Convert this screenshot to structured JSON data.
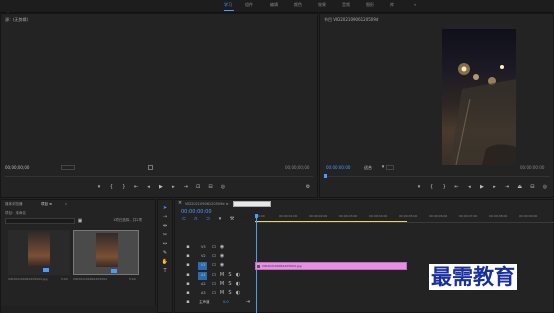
{
  "menubar": {
    "workspaces": [
      "学习",
      "组件",
      "编辑",
      "颜色",
      "效果",
      "音频",
      "图形",
      "库"
    ],
    "active_index": 0,
    "more": "»"
  },
  "source_panel": {
    "title": "源：(无剪辑)",
    "tc_left": "00;00;00;00",
    "tc_right": "00;00;00;00"
  },
  "program_panel": {
    "title": "节目 VID20210906120509d",
    "tc_left": "00:00:00:00",
    "fit": "适合",
    "tc_right": "00:00:00:00"
  },
  "project_panel": {
    "tabs": [
      "媒体浏览器",
      "项目 ≡",
      "»"
    ],
    "project_name": "项目：未命名",
    "search_placeholder": "",
    "items_label": "1项已选择，共2项",
    "items": [
      {
        "name": "VID20210906120509d.jpg",
        "duration": "5:00"
      },
      {
        "name": "VID20210906120509d",
        "duration": "5:00"
      }
    ]
  },
  "timeline": {
    "tab_label": "VID20210906120509d ≡",
    "tooltip": "标记点 (Ctrl+Shift+C)",
    "timecode": "00:00:00:00",
    "ruler": [
      ":00:00",
      "00:00:01:00",
      "00:00:02:00",
      "00:00:03:00",
      "00:00:04:00",
      "00:00:05:00",
      "00:00:06:00",
      "00:00:07:00",
      "00:00:08:00",
      "00:00:09:00"
    ],
    "video_tracks": [
      "V3",
      "V2",
      "V1"
    ],
    "audio_tracks": [
      "A1",
      "A2",
      "A3"
    ],
    "master": "主声道",
    "master_value": "0.0",
    "clip_label": "VID20210906120509d.jpg",
    "clip_color": "#e88fe4"
  },
  "watermark": "最需教育",
  "colors": {
    "accent": "#4a9bff",
    "clip": "#e88fe4",
    "playhead": "#4a9bff"
  }
}
